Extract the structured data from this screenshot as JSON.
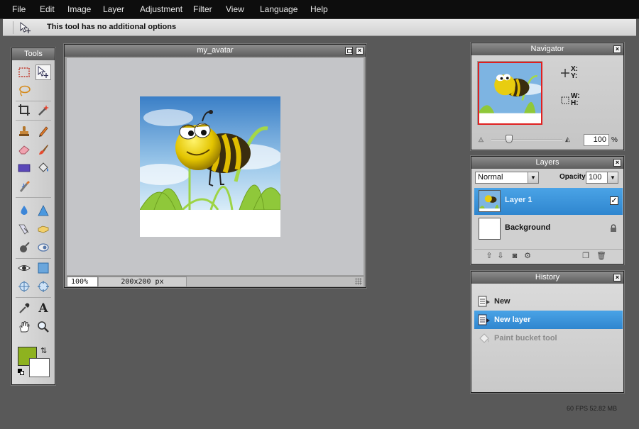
{
  "menu": [
    "File",
    "Edit",
    "Image",
    "Layer",
    "Adjustment",
    "Filter",
    "View",
    "Language",
    "Help"
  ],
  "options_bar": {
    "message": "This tool has no additional options",
    "tool_icon": "move-tool-icon"
  },
  "tools_panel": {
    "title": "Tools",
    "tools": [
      {
        "name": "marquee-select-tool",
        "icon": "dashed-rect-icon"
      },
      {
        "name": "move-tool",
        "icon": "move-arrow-icon",
        "active": true
      },
      {
        "name": "lasso-tool",
        "icon": "lasso-icon"
      },
      {
        "name": "crop-tool",
        "icon": "crop-icon"
      },
      {
        "name": "magic-wand-tool",
        "icon": "magic-wand-icon"
      },
      {
        "name": "stamp-tool",
        "icon": "stamp-icon"
      },
      {
        "name": "pencil-tool",
        "icon": "pencil-icon"
      },
      {
        "name": "eraser-tool",
        "icon": "eraser-icon"
      },
      {
        "name": "brush-tool",
        "icon": "brush-icon"
      },
      {
        "name": "rectangle-tool",
        "icon": "rectangle-icon"
      },
      {
        "name": "paint-bucket-tool",
        "icon": "bucket-icon"
      },
      {
        "name": "smudge-pen-tool",
        "icon": "pen-icon"
      },
      {
        "name": "blur-tool",
        "icon": "drop-icon"
      },
      {
        "name": "sharpen-tool",
        "icon": "triangle-icon"
      },
      {
        "name": "colour-replace-tool",
        "icon": "replace-icon"
      },
      {
        "name": "sponge-tool",
        "icon": "sponge-icon"
      },
      {
        "name": "burn-tool",
        "icon": "burn-icon"
      },
      {
        "name": "dodge-tool",
        "icon": "dodge-icon"
      },
      {
        "name": "red-eye-tool",
        "icon": "eye-icon"
      },
      {
        "name": "clone-tool",
        "icon": "square-icon"
      },
      {
        "name": "bloat-tool",
        "icon": "bloat-icon"
      },
      {
        "name": "pinch-tool",
        "icon": "pinch-icon"
      },
      {
        "name": "eyedropper-tool",
        "icon": "eyedropper-icon"
      },
      {
        "name": "type-tool",
        "icon": "type-icon",
        "glyph": "A"
      },
      {
        "name": "hand-tool",
        "icon": "hand-icon"
      },
      {
        "name": "zoom-tool",
        "icon": "zoom-icon"
      }
    ],
    "foreground_color": "#8eb21f",
    "background_color": "#ffffff"
  },
  "document": {
    "title": "my_avatar",
    "zoom": "100%",
    "size": "200x200 px"
  },
  "navigator": {
    "title": "Navigator",
    "x_label": "X:",
    "y_label": "Y:",
    "w_label": "W:",
    "h_label": "H:",
    "zoom_value": "100",
    "zoom_unit": "%",
    "zoom_level": 0.25
  },
  "layers": {
    "title": "Layers",
    "blend_mode": "Normal",
    "opacity_label": "Opacity:",
    "opacity_value": "100",
    "items": [
      {
        "name": "Layer 1",
        "selected": true,
        "visible": true
      },
      {
        "name": "Background",
        "selected": false,
        "locked": true
      }
    ]
  },
  "history": {
    "title": "History",
    "items": [
      {
        "label": "New",
        "state": "done"
      },
      {
        "label": "New layer",
        "state": "current"
      },
      {
        "label": "Paint bucket tool",
        "state": "undone"
      }
    ]
  },
  "status": {
    "stats": "60 FPS 52.82 MB"
  },
  "colors": {
    "accent": "#3a93d8",
    "menubar": "#0d0d0d",
    "workspace": "#595959"
  }
}
